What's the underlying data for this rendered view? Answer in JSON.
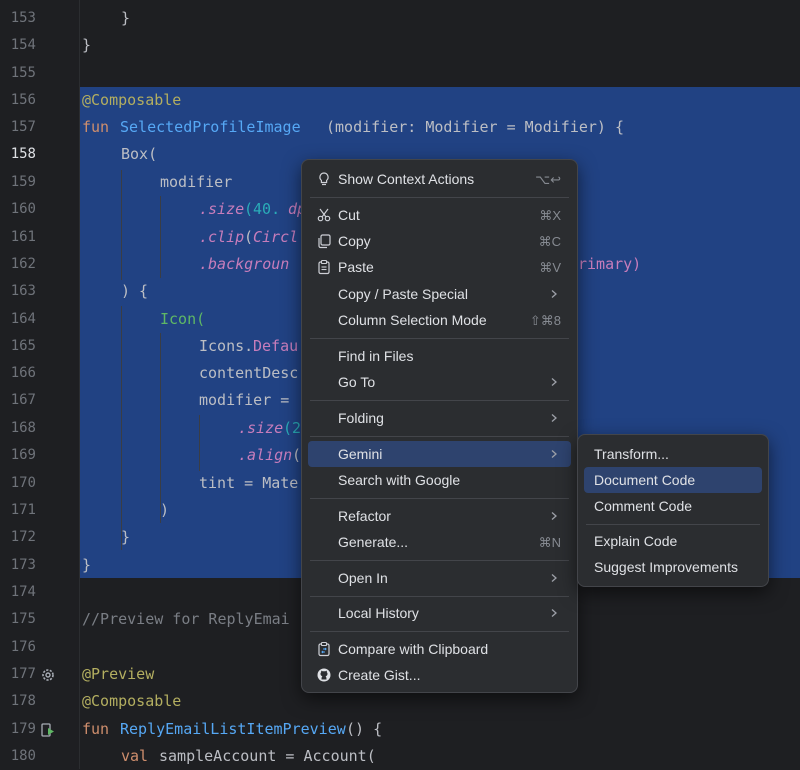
{
  "gutter": {
    "line_numbers": [
      "153",
      "154",
      "155",
      "156",
      "157",
      "158",
      "159",
      "160",
      "161",
      "162",
      "163",
      "164",
      "165",
      "166",
      "167",
      "168",
      "169",
      "170",
      "171",
      "172",
      "173",
      "174",
      "175",
      "176",
      "177",
      "178",
      "179",
      "180"
    ],
    "current_line": "158"
  },
  "code": {
    "l153": "}",
    "l154": "}",
    "l156_annotation": "@Composable",
    "l157_kw": "fun",
    "l157_name": "SelectedProfileImage",
    "l157_rest": "(modifier: Modifier = Modifier) {",
    "l158": "Box(",
    "l159": "modifier",
    "l160_fn": ".size",
    "l160_rest": "(40.",
    "l160_unit": "dp",
    "l161_fn": ".clip",
    "l161_rest": "(",
    "l161_partial": "Circl",
    "l162_fn": ".backgroun",
    "l162_right": "rimary)",
    "l163": ") {",
    "l164": "Icon(",
    "l165_a": "Icons.",
    "l165_b": "Defau",
    "l166": "contentDesc",
    "l167": "modifier =",
    "l168_fn": ".size",
    "l168_rest": "(2",
    "l169_fn": ".align",
    "l169_rest": "(",
    "l170": "tint = Mate",
    "l171": ")",
    "l172": "}",
    "l173": "}",
    "l175": "//Preview for ReplyEmai",
    "l177": "@Preview",
    "l178": "@Composable",
    "l179_kw": "fun",
    "l179_name": "ReplyEmailListItemPreview",
    "l179_rest": "() {",
    "l180_kw": "val",
    "l180_rest": "sampleAccount = Account("
  },
  "context_menu": {
    "show_context_actions": {
      "label": "Show Context Actions",
      "shortcut": "⌥↩",
      "icon": "bulb-icon"
    },
    "cut": {
      "label": "Cut",
      "shortcut": "⌘X",
      "icon": "scissors-icon"
    },
    "copy": {
      "label": "Copy",
      "shortcut": "⌘C",
      "icon": "copy-icon"
    },
    "paste": {
      "label": "Paste",
      "shortcut": "⌘V",
      "icon": "clipboard-icon"
    },
    "copy_paste_special": {
      "label": "Copy / Paste Special"
    },
    "column_selection_mode": {
      "label": "Column Selection Mode",
      "shortcut": "⇧⌘8"
    },
    "find_in_files": {
      "label": "Find in Files"
    },
    "go_to": {
      "label": "Go To"
    },
    "folding": {
      "label": "Folding"
    },
    "gemini": {
      "label": "Gemini"
    },
    "search_with_google": {
      "label": "Search with Google"
    },
    "refactor": {
      "label": "Refactor"
    },
    "generate": {
      "label": "Generate...",
      "shortcut": "⌘N"
    },
    "open_in": {
      "label": "Open In"
    },
    "local_history": {
      "label": "Local History"
    },
    "compare_with_clipboard": {
      "label": "Compare with Clipboard",
      "icon": "compare-icon"
    },
    "create_gist": {
      "label": "Create Gist...",
      "icon": "github-icon"
    }
  },
  "gemini_submenu": {
    "transform": "Transform...",
    "document_code": "Document Code",
    "comment_code": "Comment Code",
    "explain_code": "Explain Code",
    "suggest_improvements": "Suggest Improvements",
    "highlighted": "Document Code"
  },
  "colors": {
    "editor_bg": "#1e1f22",
    "selection": "#214283",
    "menu_bg": "#2b2d30",
    "menu_highlight": "#2e436e",
    "keyword": "#cf8e6d",
    "annotation": "#b3ae60",
    "function": "#56a8f5"
  }
}
